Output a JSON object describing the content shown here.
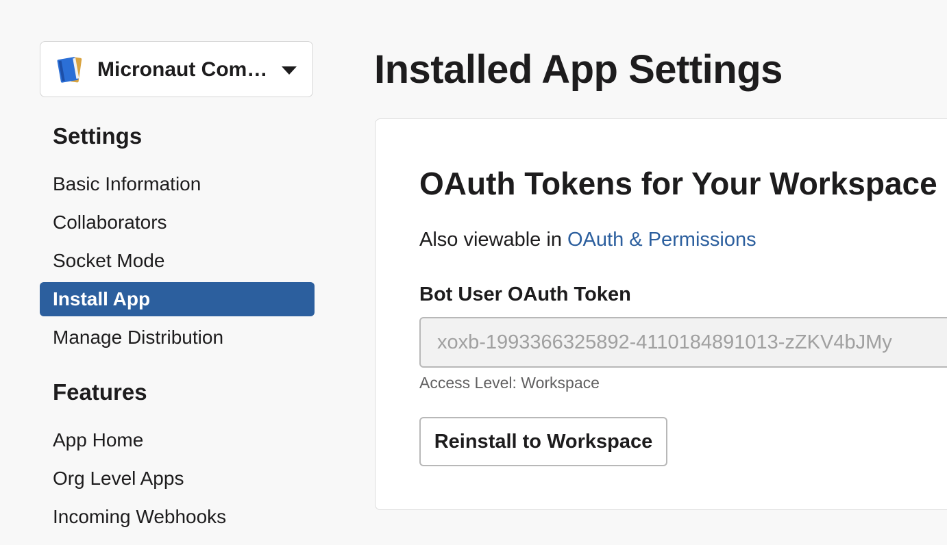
{
  "sidebar": {
    "app_picker": {
      "name": "Micronaut Com…",
      "icon": "blue-notebook-icon"
    },
    "sections": [
      {
        "title": "Settings",
        "items": [
          {
            "label": "Basic Information",
            "active": false
          },
          {
            "label": "Collaborators",
            "active": false
          },
          {
            "label": "Socket Mode",
            "active": false
          },
          {
            "label": "Install App",
            "active": true
          },
          {
            "label": "Manage Distribution",
            "active": false
          }
        ]
      },
      {
        "title": "Features",
        "items": [
          {
            "label": "App Home",
            "active": false
          },
          {
            "label": "Org Level Apps",
            "active": false
          },
          {
            "label": "Incoming Webhooks",
            "active": false
          }
        ]
      }
    ]
  },
  "main": {
    "page_title": "Installed App Settings",
    "card": {
      "title": "OAuth Tokens for Your Workspace",
      "also_viewable_prefix": "Also viewable in ",
      "also_viewable_link": "OAuth & Permissions",
      "token_label": "Bot User OAuth Token",
      "token_value": "xoxb-1993366325892-4110184891013-zZKV4bJMy",
      "access_level": "Access Level: Workspace",
      "reinstall_button": "Reinstall to Workspace"
    }
  },
  "colors": {
    "accent": "#2c5f9e",
    "background": "#f8f8f8"
  }
}
